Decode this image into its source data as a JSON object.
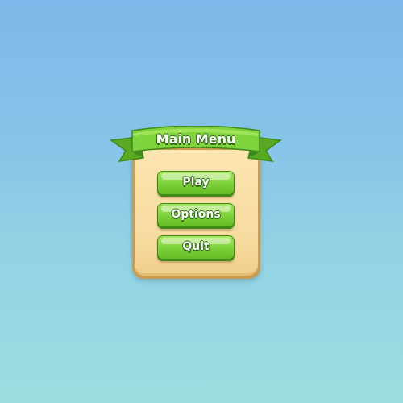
{
  "menu": {
    "title": "Main Menu",
    "buttons": [
      {
        "label": "Play"
      },
      {
        "label": "Options"
      },
      {
        "label": "Quit"
      }
    ]
  },
  "colors": {
    "sky_top": "#7db9ea",
    "sky_bottom": "#9bdde0",
    "panel_fill": "#f7dba0",
    "panel_border": "#c99d4f",
    "ribbon_green": "#7fd33c",
    "ribbon_dark": "#3f8a1c",
    "button_green": "#7fd33c",
    "text_outline": "#2f6b12"
  }
}
